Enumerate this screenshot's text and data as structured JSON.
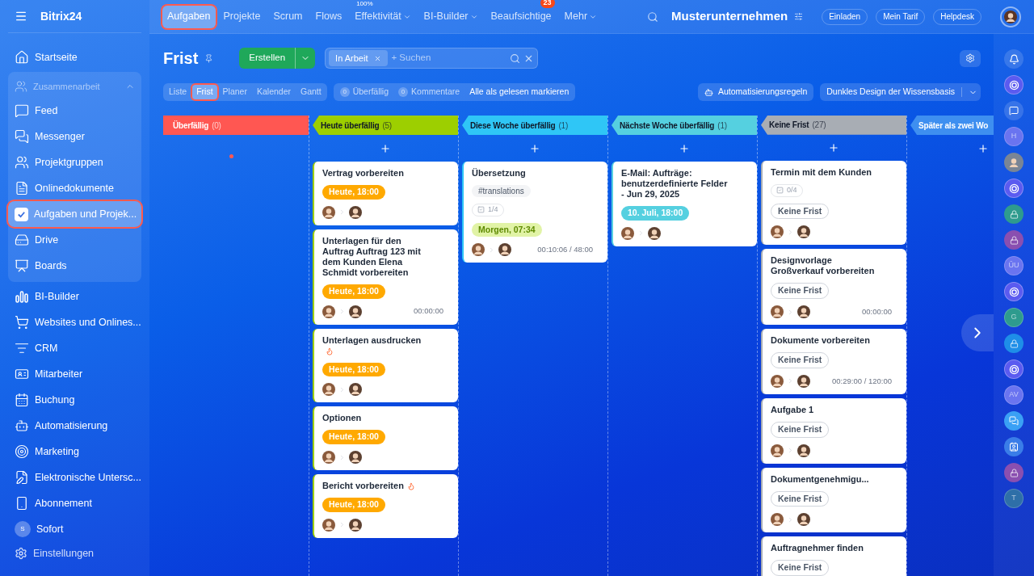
{
  "sidebar": {
    "logo": "Bitrix24",
    "items": [
      {
        "label": "Startseite",
        "selected": false
      },
      {
        "label": "Zusammenarbeit",
        "kind": "group",
        "expanded": true,
        "children": [
          {
            "label": "Feed",
            "selected": false
          },
          {
            "label": "Messenger",
            "selected": false
          },
          {
            "label": "Projektgruppen",
            "selected": false
          },
          {
            "label": "Onlinedokumente",
            "selected": false
          },
          {
            "label": "Aufgaben und Projek...",
            "selected": true
          },
          {
            "label": "Drive",
            "selected": false
          },
          {
            "label": "Boards",
            "selected": false
          }
        ]
      },
      {
        "label": "BI-Builder",
        "selected": false
      },
      {
        "label": "Websites und Onlines...",
        "selected": false
      },
      {
        "label": "CRM",
        "selected": false
      },
      {
        "label": "Mitarbeiter",
        "selected": false
      },
      {
        "label": "Buchung",
        "selected": false
      },
      {
        "label": "Automatisierung",
        "selected": false
      },
      {
        "label": "Marketing",
        "selected": false
      },
      {
        "label": "Elektronische Untersc...",
        "selected": false
      },
      {
        "label": "Abonnement",
        "selected": false
      },
      {
        "label": "Sofort",
        "selected": false,
        "avatar": "S"
      }
    ],
    "settings": "Einstellungen"
  },
  "top_nav": {
    "tabs": [
      {
        "label": "Aufgaben",
        "selected": true
      },
      {
        "label": "Projekte",
        "selected": false
      },
      {
        "label": "Scrum",
        "selected": false
      },
      {
        "label": "Flows",
        "selected": false
      },
      {
        "label": "Effektivität",
        "selected": false,
        "dropdown": true,
        "superscript": "100%"
      },
      {
        "label": "BI-Builder",
        "selected": false,
        "dropdown": true
      },
      {
        "label": "Beaufsichtige",
        "selected": false,
        "badge": "23"
      },
      {
        "label": "Mehr",
        "selected": false,
        "dropdown": true
      }
    ],
    "company": "Musterunternehmen",
    "buttons": [
      "Einladen",
      "Mein Tarif",
      "Helpdesk"
    ]
  },
  "page": {
    "title": "Frist",
    "create_button": "Erstellen",
    "filter": {
      "chip": "In Arbeit",
      "placeholder": "+ Suchen"
    },
    "view_tabs": [
      {
        "label": "Liste",
        "selected": false
      },
      {
        "label": "Frist",
        "selected": true
      },
      {
        "label": "Planer",
        "selected": false
      },
      {
        "label": "Kalender",
        "selected": false
      },
      {
        "label": "Gantt",
        "selected": false
      }
    ],
    "counters": [
      {
        "count": "0",
        "label": "Überfällig"
      },
      {
        "count": "0",
        "label": "Kommentare"
      }
    ],
    "mark_read": "Alle als gelesen markieren",
    "automation": "Automatisierungsregeln",
    "theme_select": "Dunkles Design der Wissensbasis"
  },
  "columns": [
    {
      "title": "Überfällig",
      "count": "(0)",
      "color": "#ff5752",
      "add": false
    },
    {
      "title": "Heute überfällig",
      "count": "(5)",
      "color": "#9dcf00",
      "add": true,
      "cards": [
        {
          "title": "Vertrag vorbereiten",
          "flame": false,
          "deadline": {
            "kind": "today",
            "text": "Heute, 18:00"
          }
        },
        {
          "title": "Unterlagen für den Auftrag Auftrag 123 mit dem Kunden Elena Schmidt vorbereiten",
          "flame": false,
          "deadline": {
            "kind": "today",
            "text": "Heute, 18:00"
          },
          "time": "00:00:00"
        },
        {
          "title": "Unterlagen ausdrucken",
          "flame": true,
          "deadline": {
            "kind": "today",
            "text": "Heute, 18:00"
          }
        },
        {
          "title": "Optionen",
          "flame": false,
          "deadline": {
            "kind": "today",
            "text": "Heute, 18:00"
          }
        },
        {
          "title": "Bericht vorbereiten",
          "flame": true,
          "deadline": {
            "kind": "today",
            "text": "Heute, 18:00"
          }
        }
      ]
    },
    {
      "title": "Diese Woche überfällig",
      "count": "(1)",
      "color": "#2fc6f6",
      "add": true,
      "cards": [
        {
          "title": "Übersetzung",
          "flame": false,
          "tag": "#translations",
          "checklist": "1/4",
          "deadline": {
            "kind": "tomorrow",
            "text": "Morgen, 07:34"
          },
          "time": "00:10:06 / 48:00"
        }
      ]
    },
    {
      "title": "Nächste Woche überfällig",
      "count": "(1)",
      "color": "#55d0e0",
      "add": true,
      "cards": [
        {
          "title": "E-Mail: Aufträge: benutzerdefinierte Felder - Jun 29, 2025",
          "flame": false,
          "deadline": {
            "kind": "date",
            "text": "10. Juli, 18:00"
          }
        }
      ]
    },
    {
      "title": "Keine Frist",
      "count": "(27)",
      "color": "#a8adb4",
      "add": true,
      "cards": [
        {
          "title": "Termin mit dem Kunden",
          "flame": false,
          "checklist": "0/4",
          "deadline": {
            "kind": "none",
            "text": "Keine Frist"
          }
        },
        {
          "title": "Designvorlage Großverkauf vorbereiten",
          "flame": false,
          "deadline": {
            "kind": "none",
            "text": "Keine Frist"
          },
          "time": "00:00:00"
        },
        {
          "title": "Dokumente vorbereiten",
          "flame": false,
          "deadline": {
            "kind": "none",
            "text": "Keine Frist"
          },
          "time": "00:29:00 / 120:00"
        },
        {
          "title": "Aufgabe 1",
          "flame": false,
          "deadline": {
            "kind": "none",
            "text": "Keine Frist"
          }
        },
        {
          "title": "Dokumentgenehmigu...",
          "flame": false,
          "deadline": {
            "kind": "none",
            "text": "Keine Frist"
          }
        },
        {
          "title": "Auftragnehmer finden",
          "flame": false,
          "deadline": {
            "kind": "none",
            "text": "Keine Frist"
          },
          "assignees_visible": false
        }
      ]
    },
    {
      "title": "Später als zwei Wo",
      "color": "#3e8ff0",
      "add": true
    }
  ],
  "right_rail": [
    {
      "kind": "bell"
    },
    {
      "kind": "copilot"
    },
    {
      "kind": "chat"
    },
    {
      "kind": "letter",
      "text": "H"
    },
    {
      "kind": "avatar"
    },
    {
      "kind": "copilot"
    },
    {
      "kind": "lock",
      "color": "#2e9b8e"
    },
    {
      "kind": "lock",
      "color": "#8a4fb0"
    },
    {
      "kind": "letter",
      "text": "ÜU"
    },
    {
      "kind": "copilot"
    },
    {
      "kind": "letter",
      "text": "G",
      "color": "#2e9b8e"
    },
    {
      "kind": "lock",
      "color": "#1e8ee8"
    },
    {
      "kind": "copilot"
    },
    {
      "kind": "letter",
      "text": "AV"
    },
    {
      "kind": "messages"
    },
    {
      "kind": "card"
    },
    {
      "kind": "lock",
      "color": "#8a4fb0"
    },
    {
      "kind": "letter",
      "text": "T",
      "color": "#2e6fa8"
    }
  ]
}
